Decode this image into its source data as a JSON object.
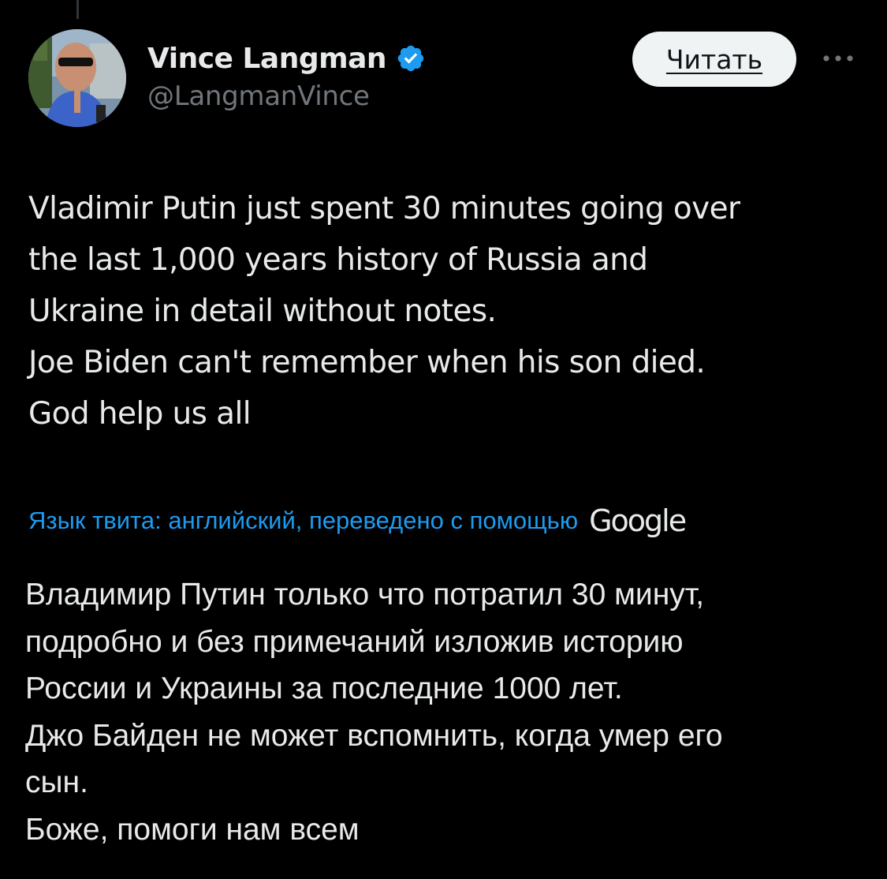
{
  "author": {
    "name": "Vince Langman",
    "handle": "@LangmanVince",
    "verified_icon": "verified-badge-icon",
    "avatar_icon": "avatar-photo"
  },
  "follow_button": {
    "label": "Читать"
  },
  "more_menu": {
    "icon": "more-horizontal-icon"
  },
  "tweet": {
    "lines": [
      "Vladimir Putin just spent 30 minutes going over",
      "the last 1,000 years history of Russia and",
      "Ukraine in detail without notes.",
      "Joe Biden can't remember when his son died.",
      "God help us all"
    ]
  },
  "translation": {
    "note": "Язык твита: английский, переведено с помощью",
    "provider": "Google",
    "lines": [
      "Владимир Путин только что потратил 30 минут,",
      "подробно и без примечаний изложив историю",
      "России и Украины за последние 1000 лет.",
      "Джо Байден не может вспомнить, когда умер его",
      "сын.",
      "Боже, помоги нам всем"
    ]
  },
  "colors": {
    "background": "#000000",
    "text_primary": "#e7e9ea",
    "text_secondary": "#71767b",
    "accent": "#1d9bf0",
    "button_bg": "#eff3f4"
  }
}
